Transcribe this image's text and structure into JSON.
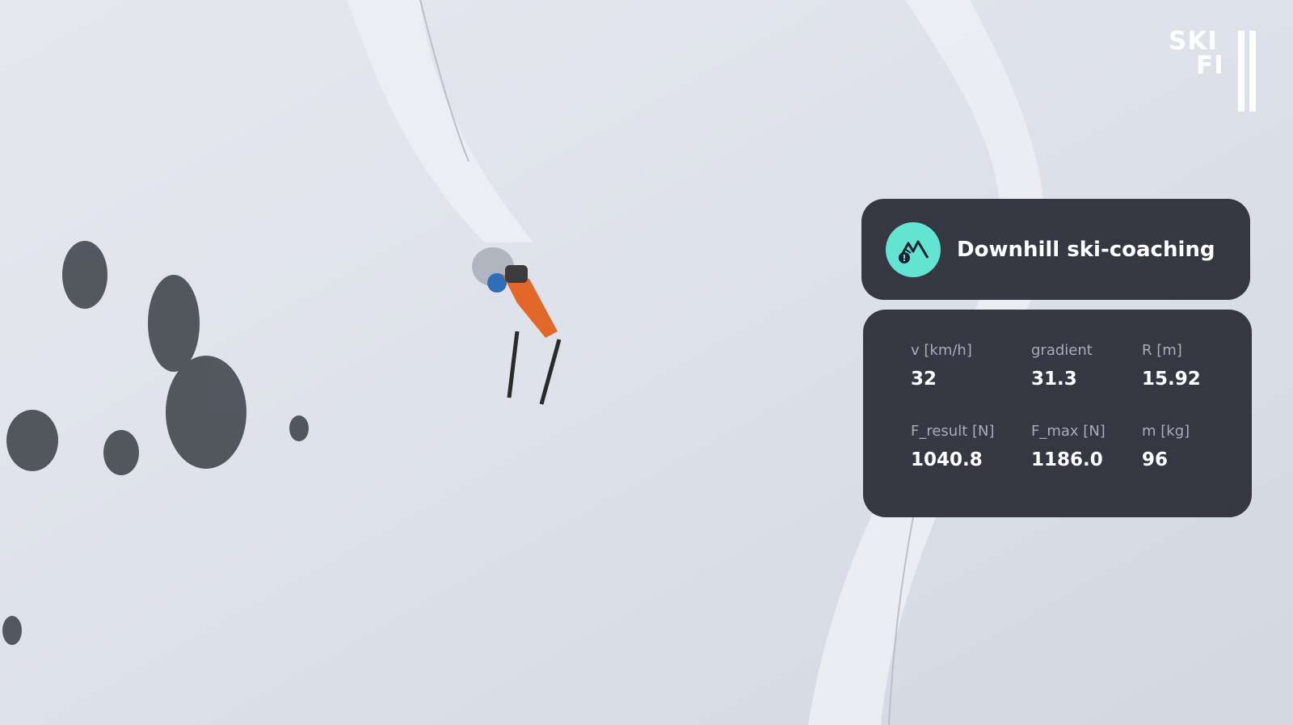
{
  "scene": {
    "description_icon": "aerial-ski-slope-photo"
  },
  "brand": {
    "line1": "SKI",
    "line2": "FI"
  },
  "header": {
    "title": "Downhill ski-coaching",
    "icon": "mountain-alert-icon",
    "icon_color": "#63e3d1"
  },
  "metrics": [
    {
      "label": "v [km/h]",
      "value": "32"
    },
    {
      "label": "gradient",
      "value": "31.3"
    },
    {
      "label": "R [m]",
      "value": "15.92"
    },
    {
      "label": "F_result [N]",
      "value": "1040.8"
    },
    {
      "label": "F_max [N]",
      "value": "1186.0"
    },
    {
      "label": "m [kg]",
      "value": "96"
    }
  ],
  "colors": {
    "card_bg": "#2a2d38",
    "label_text": "#a7adb9",
    "value_text": "#ffffff",
    "accent": "#63e3d1"
  }
}
